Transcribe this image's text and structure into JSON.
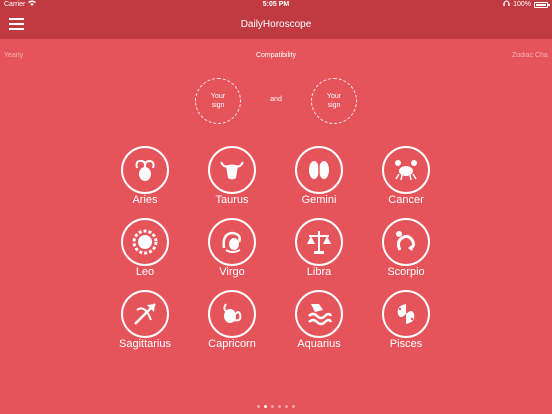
{
  "status": {
    "carrier": "Carrier",
    "time": "5:05 PM",
    "battery": "100%"
  },
  "header": {
    "title": "DailyHoroscope"
  },
  "tabs": {
    "yearly": "Yearly",
    "compatibility": "Compatibility",
    "zodiac": "Zodiac Cha"
  },
  "compat": {
    "left": "Your sign",
    "and": "and",
    "right": "Your sign"
  },
  "signs": [
    "Aries",
    "Taurus",
    "Gemini",
    "Cancer",
    "Leo",
    "Virgo",
    "Libra",
    "Scorpio",
    "Sagittarius",
    "Capricorn",
    "Aquarius",
    "Pisces"
  ],
  "colors": {
    "background": "#e5535b",
    "bar": "#c03a42",
    "foreground": "#ffffff"
  },
  "pager": {
    "count": 6,
    "active": 2
  }
}
